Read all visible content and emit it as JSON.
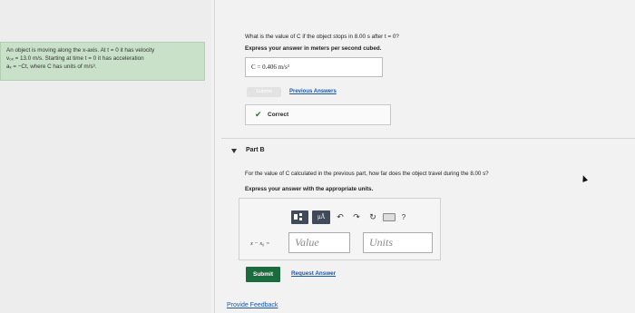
{
  "problem": {
    "lines": [
      "An object is moving along the x-axis. At t = 0 it has velocity",
      "v₀ₓ = 13.0 m/s. Starting at time t = 0 it has acceleration",
      "aₓ = −Ct, where C has units of m/s³."
    ]
  },
  "part_a": {
    "question": "What is the value of C if the object stops in 8.00 s after t = 0?",
    "instruction": "Express your answer in meters per second cubed.",
    "answer_value": "C =  0.406  m/s³",
    "submit_label": "Submit",
    "previous_answers_label": "Previous Answers",
    "status_label": "Correct"
  },
  "part_b": {
    "title": "Part B",
    "question": "For the value of C calculated in the previous part, how far does the object travel during the 8.00 s?",
    "instruction": "Express your answer with the appropriate units.",
    "equation_label": "x − x₀ =",
    "value_placeholder": "Value",
    "units_placeholder": "Units",
    "submit_label": "Submit",
    "request_answer_label": "Request Answer",
    "toolbar": {
      "micro_label": "μÅ",
      "help_label": "?"
    }
  },
  "footer": {
    "feedback_label": "Provide Feedback"
  },
  "colors": {
    "problem_bg": "#c9e1c9",
    "submit_green": "#1a6b3d",
    "link_blue": "#1a57a6"
  }
}
